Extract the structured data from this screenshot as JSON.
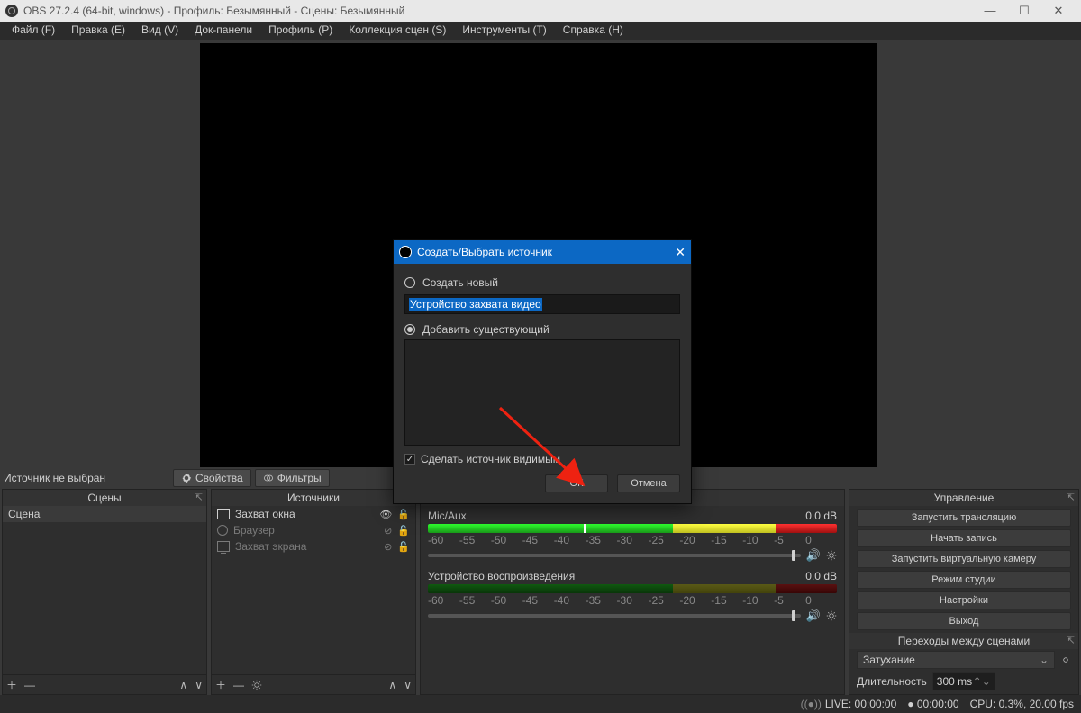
{
  "window": {
    "title": "OBS 27.2.4 (64-bit, windows) - Профиль: Безымянный - Сцены: Безымянный"
  },
  "menu": [
    "Файл (F)",
    "Правка (E)",
    "Вид (V)",
    "Док-панели",
    "Профиль (P)",
    "Коллекция сцен (S)",
    "Инструменты (T)",
    "Справка (H)"
  ],
  "toolbar": {
    "status": "Источник не выбран",
    "properties": "Свойства",
    "filters": "Фильтры"
  },
  "docks": {
    "scenes": {
      "title": "Сцены",
      "items": [
        "Сцена"
      ]
    },
    "sources": {
      "title": "Источники",
      "items": [
        {
          "icon": "window",
          "label": "Захват окна",
          "visible": true,
          "dim": false
        },
        {
          "icon": "globe",
          "label": "Браузер",
          "visible": false,
          "dim": true
        },
        {
          "icon": "screen",
          "label": "Захват экрана",
          "visible": false,
          "dim": true
        }
      ]
    },
    "mixer": {
      "channels": [
        {
          "name": "Mic/Aux",
          "db": "0.0 dB",
          "active": true
        },
        {
          "name": "Устройство воспроизведения",
          "db": "0.0 dB",
          "active": false
        }
      ],
      "scale": [
        "-60",
        "-55",
        "-50",
        "-45",
        "-40",
        "-35",
        "-30",
        "-25",
        "-20",
        "-15",
        "-10",
        "-5",
        "0"
      ]
    },
    "controls": {
      "title": "Управление",
      "buttons": [
        "Запустить трансляцию",
        "Начать запись",
        "Запустить виртуальную камеру",
        "Режим студии",
        "Настройки",
        "Выход"
      ],
      "transitions_title": "Переходы между сценами",
      "transition": "Затухание",
      "duration_label": "Длительность",
      "duration_value": "300 ms"
    }
  },
  "status": {
    "live": "LIVE: 00:00:00",
    "rec": "00:00:00",
    "cpu": "CPU: 0.3%, 20.00 fps"
  },
  "dialog": {
    "title": "Создать/Выбрать источник",
    "create_new": "Создать новый",
    "name_value": "Устройство захвата видео",
    "add_existing": "Добавить существующий",
    "make_visible": "Сделать источник видимым",
    "ok": "ОК",
    "cancel": "Отмена"
  }
}
